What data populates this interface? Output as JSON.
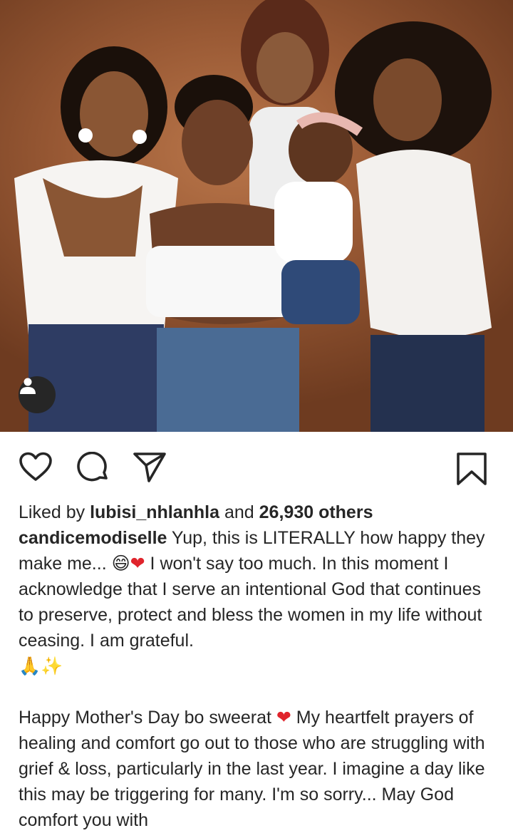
{
  "post": {
    "photo_alt": "",
    "tag_icon": "person-icon"
  },
  "actions": {
    "like_icon": "heart-outline-icon",
    "comment_icon": "comment-icon",
    "share_icon": "send-icon",
    "save_icon": "bookmark-icon"
  },
  "likes": {
    "prefix": "Liked by ",
    "user": "lubisi_nhlanhla",
    "middle": " and ",
    "count": "26,930 others"
  },
  "caption": {
    "author": "candicemodiselle",
    "p1_a": " Yup, this is LITERALLY how happy they make me... ",
    "p1_emoji1": "😄",
    "p1_emoji2": "❤",
    "p1_b": " I won't say too much. In this moment I acknowledge that I serve an intentional God that continues to preserve, protect and bless the women in my life without ceasing. I am grateful.",
    "p1_emoji3": "🙏✨",
    "p2_a": "Happy Mother's Day bo sweerat ",
    "p2_emoji": "❤",
    "p2_b": " My heartfelt prayers of healing and comfort go out to those who are struggling with grief & loss, particularly in the last year. I imagine a day like this may be triggering for many. I'm so sorry... May God comfort you with"
  }
}
